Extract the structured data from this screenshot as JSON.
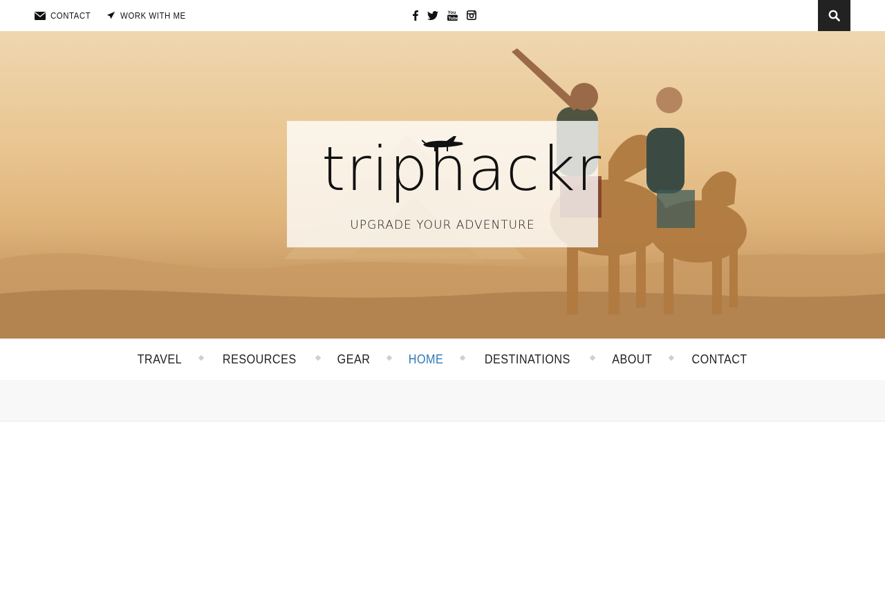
{
  "topbar": {
    "contact_label": "Contact",
    "work_label": "Work with me",
    "social": [
      "facebook-icon",
      "twitter-icon",
      "youtube-icon",
      "instagram-icon"
    ],
    "search_icon": "search-icon"
  },
  "hero": {
    "logo_text": "triphackr",
    "tagline": "UPGRADE YOUR ADVENTURE"
  },
  "nav": {
    "items": [
      {
        "label": "Travel"
      },
      {
        "label": "Resources"
      },
      {
        "label": "Gear"
      },
      {
        "label": "Home"
      },
      {
        "label": "Destinations"
      },
      {
        "label": "About"
      },
      {
        "label": "Contact"
      }
    ],
    "active": "Home"
  },
  "colors": {
    "accent": "#2a7ab8",
    "search_bg": "#222222",
    "text": "#222222"
  }
}
